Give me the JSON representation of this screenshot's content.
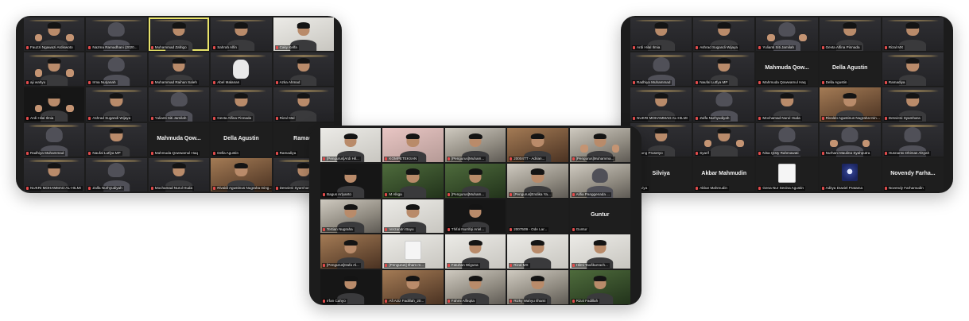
{
  "panels": [
    {
      "id": "left",
      "cols": 5,
      "tiles": [
        {
          "label": "Fauzzi Ngawazi Ardiswoto",
          "style": "person",
          "bg": "banner",
          "hands": true
        },
        {
          "label": "Nazma Ramadhani (2020...",
          "style": "hijab",
          "bg": "banner"
        },
        {
          "label": "Muhammad Zafrigo",
          "style": "person",
          "bg": "banner",
          "active": true
        },
        {
          "label": "Sahrah Alfin",
          "style": "person",
          "bg": "banner"
        },
        {
          "label": "Caky Kelfa",
          "style": "person",
          "bg": "light"
        },
        {
          "label": "aji wahyu",
          "style": "person",
          "bg": "banner",
          "hands": true
        },
        {
          "label": "Irma Nurjanah",
          "style": "hijab",
          "bg": "banner"
        },
        {
          "label": "Muhammad Raihan Saleh",
          "style": "person",
          "bg": "banner"
        },
        {
          "label": "Abel Malanan",
          "style": "robot",
          "bg": "banner"
        },
        {
          "label": "Azka Ahmad",
          "style": "person",
          "bg": "banner"
        },
        {
          "label": "Ardi Hilal Ilmia",
          "style": "person",
          "bg": "dark",
          "hands": true
        },
        {
          "label": "Ashrad Sugandi Wijaya",
          "style": "person",
          "bg": "banner"
        },
        {
          "label": "Yulianti Siti Jamilah",
          "style": "hijab",
          "bg": "banner"
        },
        {
          "label": "Gevta Alfina Pinnada",
          "style": "person",
          "bg": "banner"
        },
        {
          "label": "Rizal Mal",
          "style": "person",
          "bg": "banner"
        },
        {
          "label": "Radhiya Muhammad",
          "style": "hijab",
          "bg": "banner"
        },
        {
          "label": "Naufal Lutfya MP",
          "style": "person",
          "bg": "banner"
        },
        {
          "label": "Mahmuda Qowwamul Haq",
          "style": "name",
          "name": "Mahmuda Qow...",
          "bg": "blank"
        },
        {
          "label": "Della Agustin",
          "style": "name",
          "name": "Della Agustin",
          "bg": "blank"
        },
        {
          "label": "Ramadiya",
          "style": "name",
          "name": "Ramadi",
          "bg": "blank"
        },
        {
          "label": "NUKRI MOHAMMAD AL-HILMI",
          "style": "person",
          "bg": "banner"
        },
        {
          "label": "Zalfa Nurhyudiyah",
          "style": "hijab",
          "bg": "banner"
        },
        {
          "label": "Mochamad Nurul Huda",
          "style": "person",
          "bg": "banner"
        },
        {
          "label": "Rivaldi Agustinus Nugraha Iningw...",
          "style": "person",
          "bg": "warm"
        },
        {
          "label": "Desvieni Syamhara",
          "style": "person",
          "bg": "banner"
        }
      ]
    },
    {
      "id": "center",
      "cols": 5,
      "tiles": [
        {
          "label": "[Pengurus]Ardi Hil...",
          "style": "person",
          "bg": "light"
        },
        {
          "label": "KOMPETEKSAN",
          "style": "person",
          "bg": "pink"
        },
        {
          "label": "[Pengurus]Muham...",
          "style": "person",
          "bg": "room"
        },
        {
          "label": "20004TT - Adrian...",
          "style": "person",
          "bg": "warm"
        },
        {
          "label": "[Pengurus]Muhamma...",
          "style": "person",
          "bg": "room",
          "hands": true
        },
        {
          "label": "Bagus Arlyanto",
          "style": "person",
          "bg": "dark"
        },
        {
          "label": "M Alkga",
          "style": "person",
          "bg": "green"
        },
        {
          "label": "[Pengurus]Muham...",
          "style": "person",
          "bg": "green"
        },
        {
          "label": "[Pengurus]Endika Ya...",
          "style": "person",
          "bg": "room"
        },
        {
          "label": "Alifia Panggenada ...",
          "style": "hijab",
          "bg": "room"
        },
        {
          "label": "Tertian Nugraha",
          "style": "person",
          "bg": "room"
        },
        {
          "label": "Verzandri Bayu",
          "style": "person",
          "bg": "light"
        },
        {
          "label": "Thifal Nurrifqi Ariel...",
          "style": "person",
          "bg": "dark"
        },
        {
          "label": "2007509 - Ode Lar...",
          "style": "blank",
          "bg": "blank"
        },
        {
          "label": "Guntur",
          "style": "name",
          "name": "Guntur",
          "bg": "blank"
        },
        {
          "label": "[Pengurus]Dafa Al...",
          "style": "person",
          "bg": "warm"
        },
        {
          "label": "[Pengurus] Ilham m...",
          "style": "img-white",
          "bg": "light"
        },
        {
          "label": "Fatuhan Wiguna",
          "style": "person",
          "bg": "light"
        },
        {
          "label": "Rizal MX",
          "style": "person",
          "bg": "light"
        },
        {
          "label": "Hilmi Taufikurrach...",
          "style": "person",
          "bg": "light"
        },
        {
          "label": "Irfan Cahyo",
          "style": "person",
          "bg": "dark"
        },
        {
          "label": "Afi Aziz Fadillah_20...",
          "style": "person",
          "bg": "warm"
        },
        {
          "label": "Fahmi Alfirqita",
          "style": "person",
          "bg": "room"
        },
        {
          "label": "Rizky Wahyu Ilhami",
          "style": "person",
          "bg": "room"
        },
        {
          "label": "Rizal Fadillah",
          "style": "person",
          "bg": "green"
        }
      ]
    },
    {
      "id": "right",
      "cols": 5,
      "tiles": [
        {
          "label": "Ardi Hilal Ilmia",
          "style": "person",
          "bg": "banner"
        },
        {
          "label": "Ashrad Sugandi Wijaya",
          "style": "person",
          "bg": "banner"
        },
        {
          "label": "Yulianti Siti Jamilah",
          "style": "hijab",
          "bg": "banner",
          "hands": true
        },
        {
          "label": "Gevta Alfina Pinnada",
          "style": "person",
          "bg": "banner"
        },
        {
          "label": "Rizal MX",
          "style": "person",
          "bg": "banner"
        },
        {
          "label": "Radhiya Muhammad",
          "style": "hijab",
          "bg": "banner"
        },
        {
          "label": "Naufal Lutfya MP",
          "style": "person",
          "bg": "banner"
        },
        {
          "label": "Mahmuda Qowwamul Haq",
          "style": "name",
          "name": "Mahmuda Qow...",
          "bg": "blank"
        },
        {
          "label": "Della Agustin",
          "style": "name",
          "name": "Della Agustin",
          "bg": "blank"
        },
        {
          "label": "Ramadiya",
          "style": "person",
          "bg": "banner"
        },
        {
          "label": "NUKRI MOHAMMAD AL-HILMI",
          "style": "person",
          "bg": "banner"
        },
        {
          "label": "Zalfa Nurhyudiyah",
          "style": "hijab",
          "bg": "banner"
        },
        {
          "label": "Mochamad Nurul Huda",
          "style": "person",
          "bg": "banner"
        },
        {
          "label": "Rivaldo Agustinus Nugraha Iningw...",
          "style": "person",
          "bg": "warm"
        },
        {
          "label": "Desvieni Syamhara",
          "style": "person",
          "bg": "banner"
        },
        {
          "label": "Agung Prasetyo",
          "style": "person",
          "bg": "banner"
        },
        {
          "label": "Syarif",
          "style": "person",
          "bg": "banner",
          "hands": true
        },
        {
          "label": "Nisa Qisty Rahmawati",
          "style": "hijab",
          "bg": "banner"
        },
        {
          "label": "Nurhani Maulina Syahputra",
          "style": "hijab",
          "bg": "banner",
          "hands": true
        },
        {
          "label": "Husnanto Dhimas Alsyah",
          "style": "hijab",
          "bg": "banner"
        },
        {
          "label": "Silviya",
          "style": "name",
          "name": "Silviya",
          "bg": "blank"
        },
        {
          "label": "Akbar Mahmudin",
          "style": "name",
          "name": "Akbar Mahmudin",
          "bg": "blank"
        },
        {
          "label": "Gena Nur Sevina Agustin",
          "style": "img-white",
          "bg": "blank"
        },
        {
          "label": "Aditya Duwiel Pratama",
          "style": "img-blue",
          "bg": "blank"
        },
        {
          "label": "Novendy Farhamudin",
          "style": "name",
          "name": "Novendy Farha...",
          "bg": "blank"
        }
      ]
    }
  ]
}
